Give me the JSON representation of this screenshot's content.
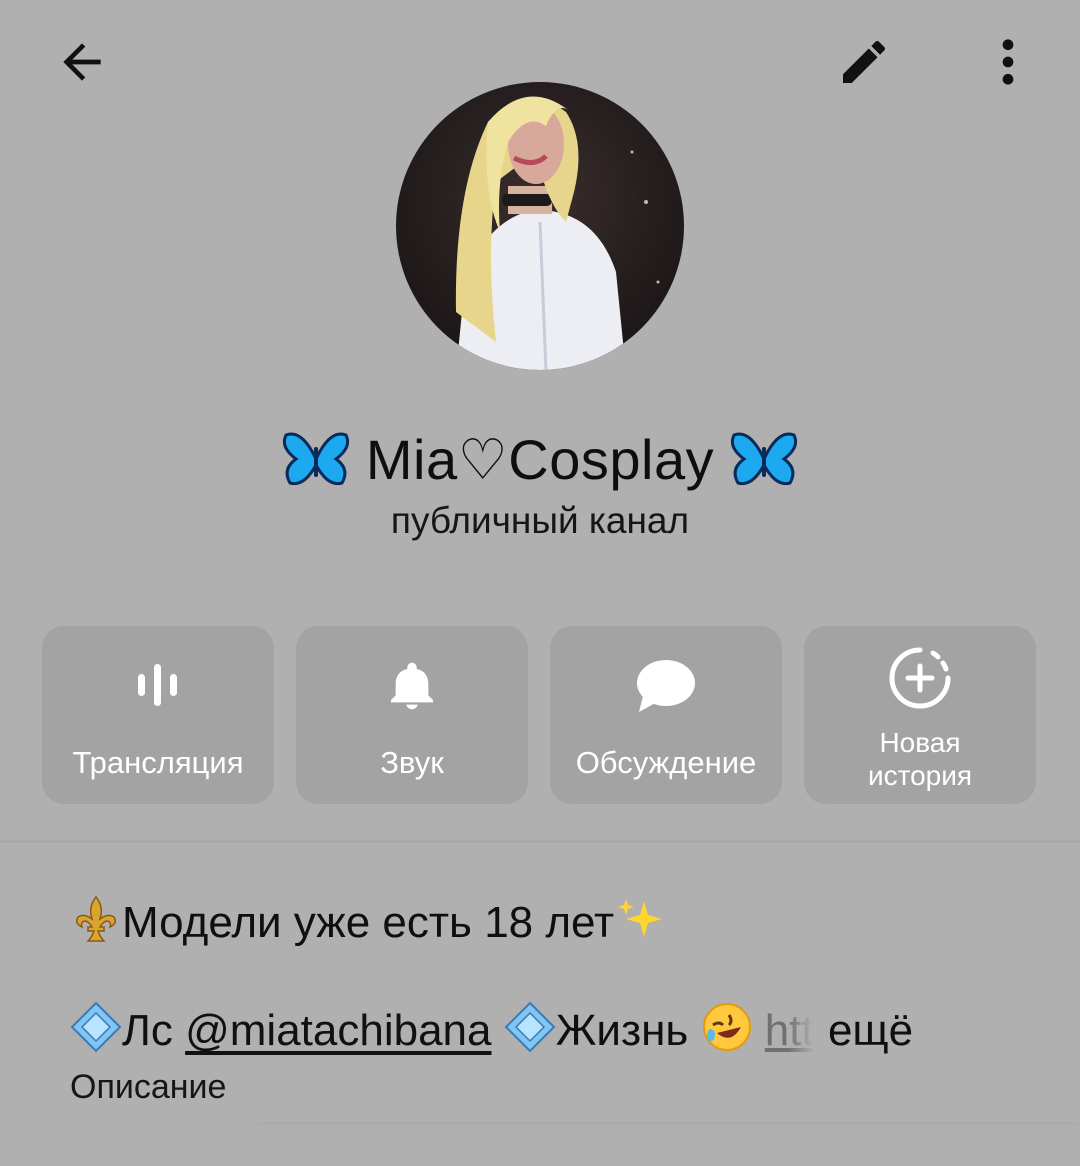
{
  "toolbar": {
    "back_icon": "arrow-left-icon",
    "edit_icon": "pencil-icon",
    "more_icon": "vertical-dots-icon"
  },
  "channel": {
    "name": "Mia♡Cosplay",
    "type": "публичный канал",
    "avatar_icon": "channel-avatar-photo"
  },
  "actions": [
    {
      "label": "Трансляция",
      "icon": "live-stream-icon"
    },
    {
      "label": "Звук",
      "icon": "bell-icon"
    },
    {
      "label": "Обсуждение",
      "icon": "chat-bubble-icon"
    },
    {
      "label_line1": "Новая",
      "label_line2": "история",
      "icon": "add-story-icon"
    }
  ],
  "description": {
    "line1": "Модели уже есть 18 лет",
    "line2_prefix": "Лс ",
    "mention": "@miatachibana",
    "line2_mid": "Жизнь ",
    "link_fragment": "htt",
    "more": "ещё",
    "label": "Описание"
  },
  "colors": {
    "background": "#b0b0b0",
    "button_background": "#a3a3a3",
    "button_text": "#ffffff",
    "text": "#111111"
  }
}
